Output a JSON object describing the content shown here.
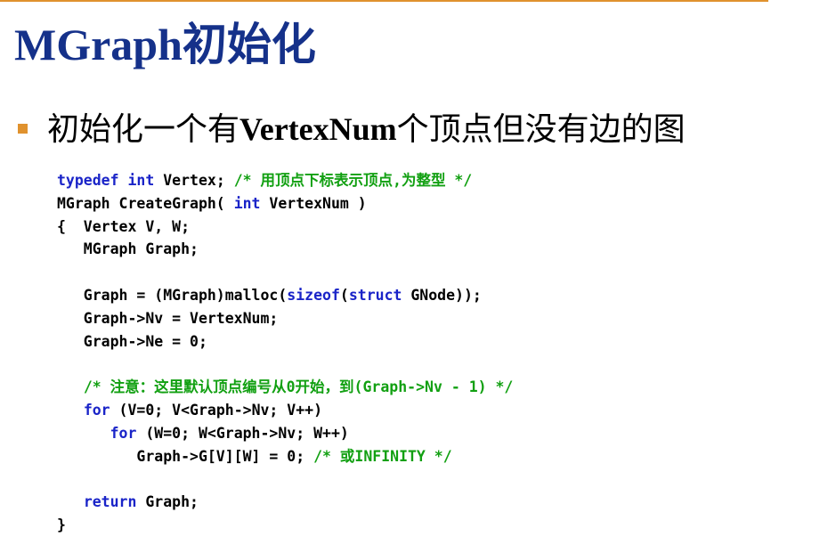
{
  "title": "MGraph初始化",
  "bullet": {
    "prefix": "初始化一个有",
    "bold": "VertexNum",
    "suffix": "个顶点但没有边的图"
  },
  "code_lines": [
    [
      {
        "t": "typedef",
        "c": "kw"
      },
      {
        "t": " "
      },
      {
        "t": "int",
        "c": "kw"
      },
      {
        "t": " Vertex; "
      },
      {
        "t": "/* 用顶点下标表示顶点,为整型 */",
        "c": "cm"
      }
    ],
    [
      {
        "t": "MGraph CreateGraph( "
      },
      {
        "t": "int",
        "c": "kw"
      },
      {
        "t": " VertexNum )"
      }
    ],
    [
      {
        "t": "{  Vertex V, W;"
      }
    ],
    [
      {
        "t": "   MGraph Graph;"
      }
    ],
    [
      {
        "t": ""
      }
    ],
    [
      {
        "t": "   Graph = (MGraph)malloc("
      },
      {
        "t": "sizeof",
        "c": "kw"
      },
      {
        "t": "("
      },
      {
        "t": "struct",
        "c": "kw"
      },
      {
        "t": " GNode));"
      }
    ],
    [
      {
        "t": "   Graph->Nv = VertexNum;"
      }
    ],
    [
      {
        "t": "   Graph->Ne = 0;"
      }
    ],
    [
      {
        "t": ""
      }
    ],
    [
      {
        "t": "   "
      },
      {
        "t": "/* 注意：这里默认顶点编号从0开始，到(Graph->Nv - 1) */",
        "c": "cm"
      }
    ],
    [
      {
        "t": "   "
      },
      {
        "t": "for",
        "c": "kw"
      },
      {
        "t": " (V=0; V<Graph->Nv; V++)"
      }
    ],
    [
      {
        "t": "      "
      },
      {
        "t": "for",
        "c": "kw"
      },
      {
        "t": " (W=0; W<Graph->Nv; W++)"
      }
    ],
    [
      {
        "t": "         Graph->G[V][W] = 0; "
      },
      {
        "t": "/* 或INFINITY */",
        "c": "cm"
      }
    ],
    [
      {
        "t": ""
      }
    ],
    [
      {
        "t": "   "
      },
      {
        "t": "return",
        "c": "kw"
      },
      {
        "t": " Graph;"
      }
    ],
    [
      {
        "t": "}"
      }
    ]
  ],
  "colors": {
    "title": "#15318a",
    "accent": "#e0922e",
    "keyword": "#1a24c8",
    "comment": "#12a012"
  }
}
